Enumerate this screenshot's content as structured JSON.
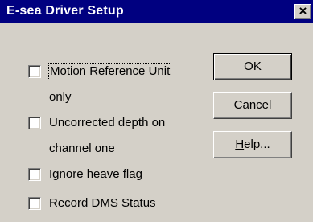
{
  "window": {
    "title": "E-sea Driver Setup",
    "close_glyph": "×"
  },
  "options": [
    {
      "label_line1": "Motion Reference Unit",
      "label_line2": "only",
      "checked": false
    },
    {
      "label_line1": "Uncorrected depth on",
      "label_line2": "channel one",
      "checked": false
    },
    {
      "label_line1": "Ignore heave flag",
      "checked": false
    },
    {
      "label_line1": "Record DMS Status",
      "checked": false
    }
  ],
  "buttons": {
    "ok": "OK",
    "cancel": "Cancel",
    "help_mnemonic": "H",
    "help_rest": "elp..."
  }
}
